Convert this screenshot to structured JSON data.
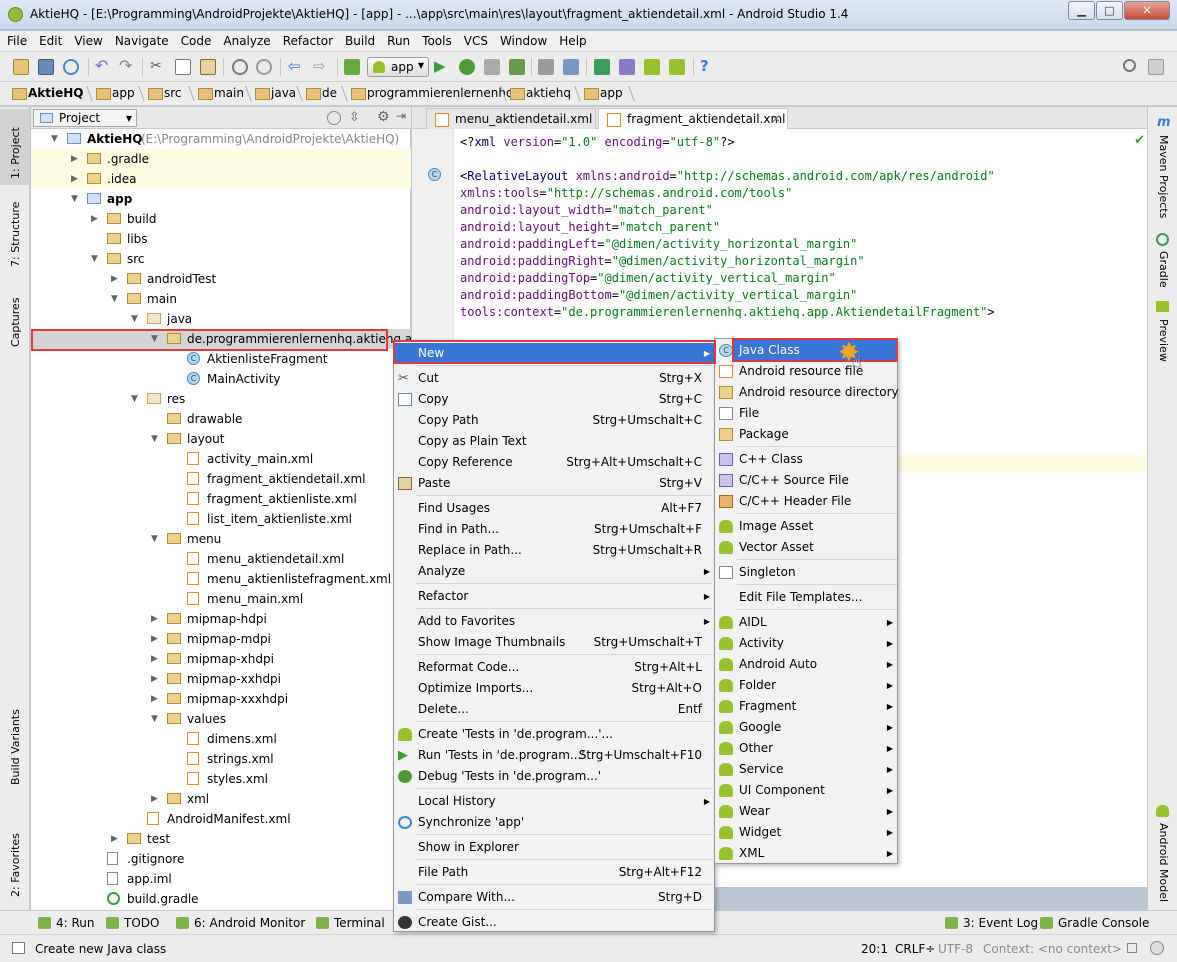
{
  "window": {
    "title": "AktieHQ - [E:\\Programming\\AndroidProjekte\\AktieHQ] - [app] - ...\\app\\src\\main\\res\\layout\\fragment_aktiendetail.xml - Android Studio 1.4",
    "minimize": "▁",
    "maximize": "□",
    "close": "✕"
  },
  "menubar": [
    "File",
    "Edit",
    "View",
    "Navigate",
    "Code",
    "Analyze",
    "Refactor",
    "Build",
    "Run",
    "Tools",
    "VCS",
    "Window",
    "Help"
  ],
  "toolbar": {
    "run_config": "app"
  },
  "breadcrumbs": [
    "AktieHQ",
    "app",
    "src",
    "main",
    "java",
    "de",
    "programmierenlernenhq",
    "aktiehq",
    "app"
  ],
  "left_tools": [
    "1: Project",
    "7: Structure",
    "Captures",
    "Build Variants",
    "2: Favorites"
  ],
  "right_tools": [
    "Maven Projects",
    "Gradle",
    "Preview",
    "Android Model"
  ],
  "project_panel": {
    "view": "Project",
    "tree": [
      {
        "label": "AktieHQ",
        "extra": " (E:\\Programming\\AndroidProjekte\\AktieHQ)",
        "depth": 0,
        "twisty": "▼",
        "icon": "mod"
      },
      {
        "label": ".gradle",
        "depth": 1,
        "twisty": "▶",
        "icon": "folder"
      },
      {
        "label": ".idea",
        "depth": 1,
        "twisty": "▶",
        "icon": "folder"
      },
      {
        "label": "app",
        "depth": 1,
        "twisty": "▼",
        "icon": "mod"
      },
      {
        "label": "build",
        "depth": 2,
        "twisty": "▶",
        "icon": "folder"
      },
      {
        "label": "libs",
        "depth": 2,
        "twisty": "",
        "icon": "folder"
      },
      {
        "label": "src",
        "depth": 2,
        "twisty": "▼",
        "icon": "folder"
      },
      {
        "label": "androidTest",
        "depth": 3,
        "twisty": "▶",
        "icon": "folder"
      },
      {
        "label": "main",
        "depth": 3,
        "twisty": "▼",
        "icon": "folder"
      },
      {
        "label": "java",
        "depth": 4,
        "twisty": "▼",
        "icon": "rfolder"
      },
      {
        "label": "de.programmierenlernenhq.aktiehq.app",
        "depth": 5,
        "twisty": "▼",
        "icon": "folder"
      },
      {
        "label": "AktienlisteFragment",
        "depth": 6,
        "twisty": "",
        "icon": "cls"
      },
      {
        "label": "MainActivity",
        "depth": 6,
        "twisty": "",
        "icon": "cls"
      },
      {
        "label": "res",
        "depth": 4,
        "twisty": "▼",
        "icon": "rfolder"
      },
      {
        "label": "drawable",
        "depth": 5,
        "twisty": "",
        "icon": "folder"
      },
      {
        "label": "layout",
        "depth": 5,
        "twisty": "▼",
        "icon": "folder"
      },
      {
        "label": "activity_main.xml",
        "depth": 6,
        "twisty": "",
        "icon": "xml"
      },
      {
        "label": "fragment_aktiendetail.xml",
        "depth": 6,
        "twisty": "",
        "icon": "xml"
      },
      {
        "label": "fragment_aktienliste.xml",
        "depth": 6,
        "twisty": "",
        "icon": "xml"
      },
      {
        "label": "list_item_aktienliste.xml",
        "depth": 6,
        "twisty": "",
        "icon": "xml"
      },
      {
        "label": "menu",
        "depth": 5,
        "twisty": "▼",
        "icon": "folder"
      },
      {
        "label": "menu_aktiendetail.xml",
        "depth": 6,
        "twisty": "",
        "icon": "xml"
      },
      {
        "label": "menu_aktienlistefragment.xml",
        "depth": 6,
        "twisty": "",
        "icon": "xml"
      },
      {
        "label": "menu_main.xml",
        "depth": 6,
        "twisty": "",
        "icon": "xml"
      },
      {
        "label": "mipmap-hdpi",
        "depth": 5,
        "twisty": "▶",
        "icon": "folder"
      },
      {
        "label": "mipmap-mdpi",
        "depth": 5,
        "twisty": "▶",
        "icon": "folder"
      },
      {
        "label": "mipmap-xhdpi",
        "depth": 5,
        "twisty": "▶",
        "icon": "folder"
      },
      {
        "label": "mipmap-xxhdpi",
        "depth": 5,
        "twisty": "▶",
        "icon": "folder"
      },
      {
        "label": "mipmap-xxxhdpi",
        "depth": 5,
        "twisty": "▶",
        "icon": "folder"
      },
      {
        "label": "values",
        "depth": 5,
        "twisty": "▼",
        "icon": "folder"
      },
      {
        "label": "dimens.xml",
        "depth": 6,
        "twisty": "",
        "icon": "xml"
      },
      {
        "label": "strings.xml",
        "depth": 6,
        "twisty": "",
        "icon": "xml"
      },
      {
        "label": "styles.xml",
        "depth": 6,
        "twisty": "",
        "icon": "xml"
      },
      {
        "label": "xml",
        "depth": 5,
        "twisty": "▶",
        "icon": "folder"
      },
      {
        "label": "AndroidManifest.xml",
        "depth": 4,
        "twisty": "",
        "icon": "xml"
      },
      {
        "label": "test",
        "depth": 3,
        "twisty": "▶",
        "icon": "folder"
      },
      {
        "label": ".gitignore",
        "depth": 2,
        "twisty": "",
        "icon": "file"
      },
      {
        "label": "app.iml",
        "depth": 2,
        "twisty": "",
        "icon": "file"
      },
      {
        "label": "build.gradle",
        "depth": 2,
        "twisty": "",
        "icon": "grad"
      }
    ]
  },
  "editor_tabs": [
    "menu_aktiendetail.xml",
    "fragment_aktiendetail.xml"
  ],
  "code_lines": [
    "<?xml version=\"1.0\" encoding=\"utf-8\"?>",
    "",
    "<RelativeLayout xmlns:android=\"http://schemas.android.com/apk/res/android\"",
    "xmlns:tools=\"http://schemas.android.com/tools\"",
    "android:layout_width=\"match_parent\"",
    "android:layout_height=\"match_parent\"",
    "android:paddingLeft=\"@dimen/activity_horizontal_margin\"",
    "android:paddingRight=\"@dimen/activity_horizontal_margin\"",
    "android:paddingTop=\"@dimen/activity_vertical_margin\"",
    "android:paddingBottom=\"@dimen/activity_vertical_margin\"",
    "tools:context=\"de.programmierenlernenhq.aktiehq.app.AktiendetailFragment\">"
  ],
  "context_menu": [
    {
      "label": "New",
      "shortcut": "",
      "submenu": true,
      "active": true,
      "icon": ""
    },
    {
      "sep": true
    },
    {
      "label": "Cut",
      "shortcut": "Strg+X",
      "icon": "cut"
    },
    {
      "label": "Copy",
      "shortcut": "Strg+C",
      "icon": "copy"
    },
    {
      "label": "Copy Path",
      "shortcut": "Strg+Umschalt+C",
      "icon": ""
    },
    {
      "label": "Copy as Plain Text",
      "shortcut": "",
      "icon": ""
    },
    {
      "label": "Copy Reference",
      "shortcut": "Strg+Alt+Umschalt+C",
      "icon": ""
    },
    {
      "label": "Paste",
      "shortcut": "Strg+V",
      "icon": "paste"
    },
    {
      "sep": true
    },
    {
      "label": "Find Usages",
      "shortcut": "Alt+F7",
      "icon": ""
    },
    {
      "label": "Find in Path...",
      "shortcut": "Strg+Umschalt+F",
      "icon": ""
    },
    {
      "label": "Replace in Path...",
      "shortcut": "Strg+Umschalt+R",
      "icon": ""
    },
    {
      "label": "Analyze",
      "shortcut": "",
      "submenu": true,
      "icon": ""
    },
    {
      "sep": true
    },
    {
      "label": "Refactor",
      "shortcut": "",
      "submenu": true,
      "icon": ""
    },
    {
      "sep": true
    },
    {
      "label": "Add to Favorites",
      "shortcut": "",
      "submenu": true,
      "icon": ""
    },
    {
      "label": "Show Image Thumbnails",
      "shortcut": "Strg+Umschalt+T",
      "icon": ""
    },
    {
      "sep": true
    },
    {
      "label": "Reformat Code...",
      "shortcut": "Strg+Alt+L",
      "icon": ""
    },
    {
      "label": "Optimize Imports...",
      "shortcut": "Strg+Alt+O",
      "icon": ""
    },
    {
      "label": "Delete...",
      "shortcut": "Entf",
      "icon": ""
    },
    {
      "sep": true
    },
    {
      "label": "Create 'Tests in 'de.program...'...",
      "shortcut": "",
      "icon": "android"
    },
    {
      "label": "Run 'Tests in 'de.program...'",
      "shortcut": "Strg+Umschalt+F10",
      "icon": "run"
    },
    {
      "label": "Debug 'Tests in 'de.program...'",
      "shortcut": "",
      "icon": "debug"
    },
    {
      "sep": true
    },
    {
      "label": "Local History",
      "shortcut": "",
      "submenu": true,
      "icon": ""
    },
    {
      "label": "Synchronize 'app'",
      "shortcut": "",
      "icon": "sync"
    },
    {
      "sep": true
    },
    {
      "label": "Show in Explorer",
      "shortcut": "",
      "icon": ""
    },
    {
      "sep": true
    },
    {
      "label": "File Path",
      "shortcut": "Strg+Alt+F12",
      "icon": ""
    },
    {
      "sep": true
    },
    {
      "label": "Compare With...",
      "shortcut": "Strg+D",
      "icon": "compare"
    },
    {
      "sep": true
    },
    {
      "label": "Create Gist...",
      "shortcut": "",
      "icon": "gist"
    }
  ],
  "new_submenu": [
    {
      "label": "Java Class",
      "icon": "cls",
      "active": true
    },
    {
      "label": "Android resource file",
      "icon": "xml"
    },
    {
      "label": "Android resource directory",
      "icon": "folder"
    },
    {
      "label": "File",
      "icon": "file"
    },
    {
      "label": "Package",
      "icon": "folder"
    },
    {
      "sep": true
    },
    {
      "label": "C++ Class",
      "icon": "cpp"
    },
    {
      "label": "C/C++ Source File",
      "icon": "cpp"
    },
    {
      "label": "C/C++ Header File",
      "icon": "hfile"
    },
    {
      "sep": true
    },
    {
      "label": "Image Asset",
      "icon": "android"
    },
    {
      "label": "Vector Asset",
      "icon": "android"
    },
    {
      "sep": true
    },
    {
      "label": "Singleton",
      "icon": "file"
    },
    {
      "sep": true
    },
    {
      "label": "Edit File Templates...",
      "icon": ""
    },
    {
      "sep": true
    },
    {
      "label": "AIDL",
      "icon": "android",
      "submenu": true
    },
    {
      "label": "Activity",
      "icon": "android",
      "submenu": true
    },
    {
      "label": "Android Auto",
      "icon": "android",
      "submenu": true
    },
    {
      "label": "Folder",
      "icon": "android",
      "submenu": true
    },
    {
      "label": "Fragment",
      "icon": "android",
      "submenu": true
    },
    {
      "label": "Google",
      "icon": "android",
      "submenu": true
    },
    {
      "label": "Other",
      "icon": "android",
      "submenu": true
    },
    {
      "label": "Service",
      "icon": "android",
      "submenu": true
    },
    {
      "label": "UI Component",
      "icon": "android",
      "submenu": true
    },
    {
      "label": "Wear",
      "icon": "android",
      "submenu": true
    },
    {
      "label": "Widget",
      "icon": "android",
      "submenu": true
    },
    {
      "label": "XML",
      "icon": "android",
      "submenu": true
    }
  ],
  "bottom_tools": [
    "4: Run",
    "TODO",
    "6: Android Monitor",
    "Terminal",
    "3: Event Log",
    "Gradle Console"
  ],
  "status": {
    "message": "Create new Java class",
    "position": "20:1",
    "line_sep": "CRLF÷",
    "encoding": "UTF-8",
    "context": "Context: <no context>"
  },
  "colors": {
    "selection": "#3875d7",
    "highlight_box": "#e03a3a",
    "android_green": "#98c12e"
  }
}
